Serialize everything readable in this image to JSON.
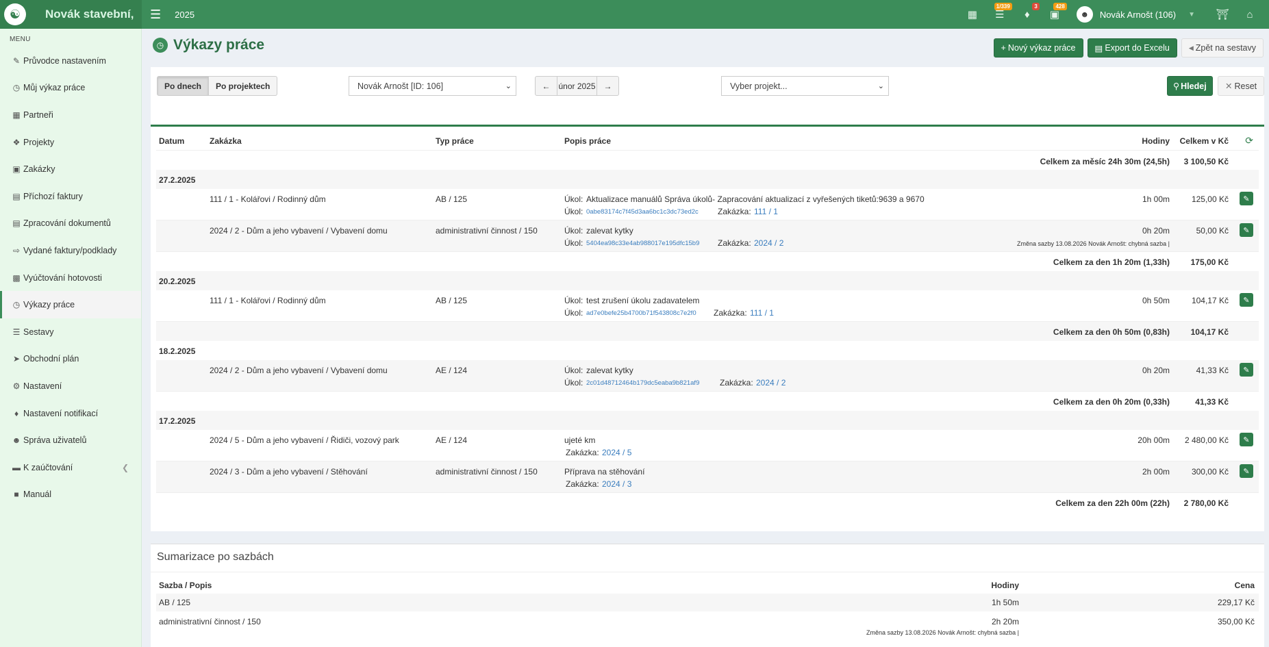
{
  "app": {
    "logo_text": "Novák stavební,",
    "year": "2025"
  },
  "topbar": {
    "badges": {
      "tasks": "1/339",
      "alerts": "3",
      "cars": "428"
    },
    "user_name": "Novák Arnošt (106)"
  },
  "sidebar": {
    "header": "MENU",
    "items": [
      {
        "label": "Průvodce nastavením",
        "icon": "pencil-icon"
      },
      {
        "label": "Můj výkaz práce",
        "icon": "clock-icon"
      },
      {
        "label": "Partneři",
        "icon": "building-icon"
      },
      {
        "label": "Projekty",
        "icon": "cubes-icon"
      },
      {
        "label": "Zakázky",
        "icon": "cube-icon"
      },
      {
        "label": "Příchozí faktury",
        "icon": "file-icon"
      },
      {
        "label": "Zpracování dokumentů",
        "icon": "file-icon"
      },
      {
        "label": "Vydané faktury/podklady",
        "icon": "file-export-icon"
      },
      {
        "label": "Vyúčtování hotovosti",
        "icon": "money-icon"
      },
      {
        "label": "Výkazy práce",
        "icon": "clock-icon"
      },
      {
        "label": "Sestavy",
        "icon": "chart-icon"
      },
      {
        "label": "Obchodní plán",
        "icon": "plane-icon"
      },
      {
        "label": "Nastavení",
        "icon": "gears-icon"
      },
      {
        "label": "Nastavení notifikací",
        "icon": "bell-icon"
      },
      {
        "label": "Správa uživatelů",
        "icon": "users-icon"
      },
      {
        "label": "K zaúčtování",
        "icon": "folder-icon"
      },
      {
        "label": "Manuál",
        "icon": "book-icon"
      }
    ]
  },
  "header": {
    "title": "Výkazy práce",
    "btn_new": "Nový výkaz práce",
    "btn_export": "Export do Excelu",
    "btn_back": "Zpět na sestavy"
  },
  "filters": {
    "by_days": "Po dnech",
    "by_projects": "Po projektech",
    "worker": "Novák Arnošt [ID: 106]",
    "month": "únor 2025",
    "project_placeholder": "Vyber projekt...",
    "search": "Hledej",
    "reset": "Reset"
  },
  "table": {
    "headers": {
      "date": "Datum",
      "order": "Zakázka",
      "type": "Typ práce",
      "desc": "Popis práce",
      "hours": "Hodiny",
      "total": "Celkem v Kč"
    },
    "month_total_label": "Celkem za měsíc 24h 30m (24,5h)",
    "month_total_value": "3 100,50 Kč",
    "days": [
      {
        "date": "27.2.2025",
        "entries": [
          {
            "order": "111 / 1 - Kolářovi / Rodinný dům",
            "type": "AB  / 125",
            "task_label": "Úkol:",
            "task_text": "Aktualizace manuálů Správa úkolů- Zapracování aktualizací z vyřešených tiketů:9639 a 9670",
            "task_id": "0abe83174c7f45d3aa6bc1c3dc73ed2c",
            "order_label": "Zakázka:",
            "order_link": "111 / 1",
            "hours": "1h 00m",
            "total": "125,00 Kč",
            "note": ""
          },
          {
            "order": "2024 / 2 - Dům a jeho vybavení / Vybavení domu",
            "type": "administrativní činnost  / 150",
            "task_label": "Úkol:",
            "task_text": "zalevat kytky",
            "task_id": "5404ea98c33e4ab988017e195dfc15b9",
            "order_label": "Zakázka:",
            "order_link": "2024 / 2",
            "hours": "0h 20m",
            "total": "50,00 Kč",
            "note": "Změna sazby 13.08.2026 Novák Arnošt: chybná sazba |"
          }
        ],
        "total_label": "Celkem za den 1h 20m (1,33h)",
        "total_value": "175,00 Kč"
      },
      {
        "date": "20.2.2025",
        "entries": [
          {
            "order": "111 / 1 - Kolářovi / Rodinný dům",
            "type": "AB  / 125",
            "task_label": "Úkol:",
            "task_text": "test zrušení úkolu zadavatelem",
            "task_id": "ad7e0befe25b4700b71f543808c7e2f0",
            "order_label": "Zakázka:",
            "order_link": "111 / 1",
            "hours": "0h 50m",
            "total": "104,17 Kč",
            "note": ""
          }
        ],
        "total_label": "Celkem za den 0h 50m (0,83h)",
        "total_value": "104,17 Kč"
      },
      {
        "date": "18.2.2025",
        "entries": [
          {
            "order": "2024 / 2 - Dům a jeho vybavení / Vybavení domu",
            "type": "AE  / 124",
            "task_label": "Úkol:",
            "task_text": "zalevat kytky",
            "task_id": "2c01d48712464b179dc5eaba9b821af9",
            "order_label": "Zakázka:",
            "order_link": "2024 / 2",
            "hours": "0h 20m",
            "total": "41,33 Kč",
            "note": ""
          }
        ],
        "total_label": "Celkem za den 0h 20m (0,33h)",
        "total_value": "41,33 Kč"
      },
      {
        "date": "17.2.2025",
        "entries": [
          {
            "order": "2024 / 5 - Dům a jeho vybavení / Řidiči, vozový park",
            "type": "AE  / 124",
            "task_label": "",
            "task_text": "ujeté km",
            "task_id": "",
            "order_label": "Zakázka:",
            "order_link": "2024 / 5",
            "hours": "20h 00m",
            "total": "2 480,00 Kč",
            "note": ""
          },
          {
            "order": "2024 / 3 - Dům a jeho vybavení / Stěhování",
            "type": "administrativní činnost  / 150",
            "task_label": "",
            "task_text": "Příprava na stěhování",
            "task_id": "",
            "order_label": "Zakázka:",
            "order_link": "2024 / 3",
            "hours": "2h 00m",
            "total": "300,00 Kč",
            "note": ""
          }
        ],
        "total_label": "Celkem za den 22h 00m (22h)",
        "total_value": "2 780,00 Kč"
      }
    ]
  },
  "summary": {
    "title": "Sumarizace po sazbách",
    "headers": {
      "rate": "Sazba / Popis",
      "hours": "Hodiny",
      "price": "Cena"
    },
    "rows": [
      {
        "rate": "AB  / 125",
        "hours": "1h 50m",
        "price": "229,17 Kč",
        "note": ""
      },
      {
        "rate": "administrativní činnost  / 150",
        "hours": "2h 20m",
        "price": "350,00 Kč",
        "note": "Změna sazby 13.08.2026 Novák Arnošt: chybná sazba |"
      }
    ]
  }
}
